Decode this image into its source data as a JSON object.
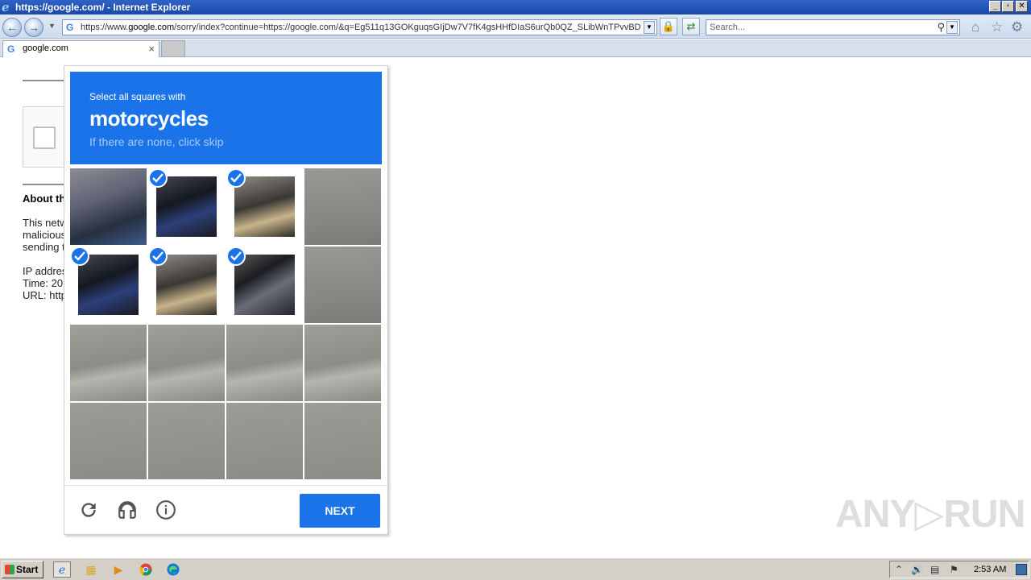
{
  "window": {
    "title": "https://google.com/ - Internet Explorer",
    "minimize": "_",
    "restore": "▫",
    "close": "✕"
  },
  "address_bar": {
    "url_prefix": "https://www.",
    "url_domain": "google.com",
    "url_rest": "/sorry/index?continue=https://google.com/&q=Eg511q13GOKguqsGIjDw7V7fK4gsHHfDIaS6urQb0QZ_SLibWnTPvvBDwE",
    "search_placeholder": "Search..."
  },
  "tab": {
    "label": "google.com",
    "close": "×"
  },
  "google_page": {
    "about_heading": "About th",
    "body_lines": [
      "This netw",
      "malicious",
      "sending t"
    ],
    "ip_line": "IP addres",
    "time_line": "Time: 20",
    "url_line": "URL: http"
  },
  "captcha": {
    "instruction_prefix": "Select all squares with",
    "target_object": "motorcycles",
    "skip_hint": "If there are none, click skip",
    "next_label": "NEXT",
    "grid_size": 4,
    "selected_cells": [
      1,
      2,
      4,
      5,
      6
    ],
    "icons": [
      "reload-icon",
      "audio-headphones-icon",
      "info-icon"
    ]
  },
  "watermark": "ANY▷RUN",
  "taskbar": {
    "start_label": "Start",
    "clock": "2:53 AM",
    "quick_launch": [
      "internet-explorer-icon",
      "folder-icon",
      "media-player-icon",
      "chrome-icon",
      "edge-icon"
    ]
  }
}
